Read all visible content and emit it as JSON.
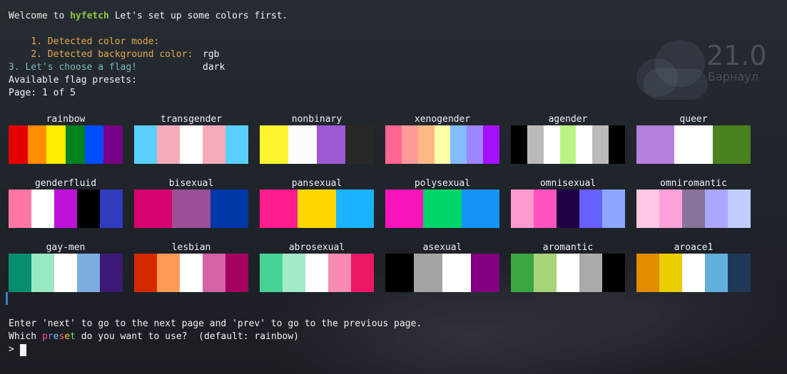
{
  "terminal": {
    "welcome": {
      "prefix": "Welcome to ",
      "brand": "hyfetch",
      "suffix": " Let's set up some colors first."
    },
    "step1": {
      "label": "1. Detected color mode:",
      "value": "rgb"
    },
    "step2": {
      "label": "2. Detected background color:",
      "value": "dark"
    },
    "step3": "3. Let's choose a flag!",
    "available": "Available flag presets:",
    "page": "Page: 1 of 5",
    "hint": "Enter 'next' to go to the next page and 'prev' to go to the previous page.",
    "question": {
      "prefix": "Which ",
      "highlight": "preset",
      "suffix": " do you want to use?  (default: rainbow)"
    },
    "prompt": ">"
  },
  "flags": [
    {
      "name": "rainbow",
      "colors": [
        "#e50000",
        "#ff8d00",
        "#ffee00",
        "#028121",
        "#004cff",
        "#770088"
      ]
    },
    {
      "name": "transgender",
      "colors": [
        "#5bcffb",
        "#f5abb9",
        "#ffffff",
        "#f5abb9",
        "#5bcffb"
      ]
    },
    {
      "name": "nonbinary",
      "colors": [
        "#fcf431",
        "#fcfcfc",
        "#9d59d2",
        "#282828"
      ]
    },
    {
      "name": "xenogender",
      "colors": [
        "#ff6692",
        "#ff9a98",
        "#ffb883",
        "#fbffa8",
        "#85bcff",
        "#9d85ff",
        "#a510ff"
      ]
    },
    {
      "name": "agender",
      "colors": [
        "#000000",
        "#bababa",
        "#ffffff",
        "#baf484",
        "#ffffff",
        "#bababa",
        "#000000"
      ]
    },
    {
      "name": "queer",
      "colors": [
        "#b57fdd",
        "#ffffff",
        "#49821e"
      ]
    },
    {
      "name": "genderfluid",
      "colors": [
        "#fe76a2",
        "#ffffff",
        "#bf12d7",
        "#000000",
        "#303cbe"
      ]
    },
    {
      "name": "bisexual",
      "colors": [
        "#d60270",
        "#9b4f96",
        "#0038a8"
      ]
    },
    {
      "name": "pansexual",
      "colors": [
        "#ff1c8d",
        "#ffd700",
        "#1ab3ff"
      ]
    },
    {
      "name": "polysexual",
      "colors": [
        "#f714ba",
        "#01d66a",
        "#1594f6"
      ]
    },
    {
      "name": "omnisexual",
      "colors": [
        "#fe9ace",
        "#ff53bf",
        "#200044",
        "#6760fe",
        "#8ea6ff"
      ]
    },
    {
      "name": "omniromantic",
      "colors": [
        "#fec8e4",
        "#fda1db",
        "#89739a",
        "#aba7fe",
        "#bfcefe"
      ]
    },
    {
      "name": "gay-men",
      "colors": [
        "#078d70",
        "#98e8c1",
        "#ffffff",
        "#7bade2",
        "#3d1a78"
      ]
    },
    {
      "name": "lesbian",
      "colors": [
        "#d62800",
        "#ff9b56",
        "#ffffff",
        "#d462a6",
        "#a40062"
      ]
    },
    {
      "name": "abrosexual",
      "colors": [
        "#46d294",
        "#a3e9ca",
        "#ffffff",
        "#f78bb3",
        "#ee1766"
      ]
    },
    {
      "name": "asexual",
      "colors": [
        "#000000",
        "#a4a4a4",
        "#ffffff",
        "#810081"
      ]
    },
    {
      "name": "aromantic",
      "colors": [
        "#3ba740",
        "#a8d47a",
        "#ffffff",
        "#ababab",
        "#000000"
      ]
    },
    {
      "name": "aroace1",
      "colors": [
        "#e28c00",
        "#eccd00",
        "#ffffff",
        "#62aedc",
        "#203856"
      ]
    }
  ],
  "weather": {
    "temperature": "21.0",
    "city": "Барнаул"
  }
}
